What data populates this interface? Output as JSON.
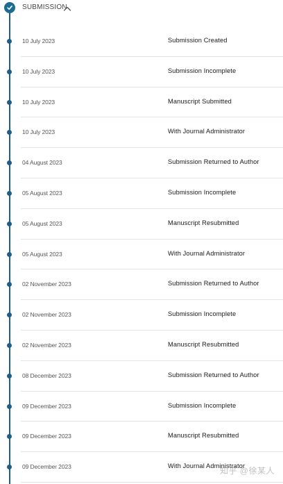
{
  "section": {
    "title": "SUBMISSION",
    "status_icon": "check-icon",
    "toggle_icon": "chevron-up-icon",
    "accent_color": "#1f5f86"
  },
  "history": [
    {
      "date": "10 July 2023",
      "status": "Submission Created"
    },
    {
      "date": "10 July 2023",
      "status": "Submission Incomplete"
    },
    {
      "date": "10 July 2023",
      "status": "Manuscript Submitted"
    },
    {
      "date": "10 July 2023",
      "status": "With Journal Administrator"
    },
    {
      "date": "04 August 2023",
      "status": "Submission Returned to Author"
    },
    {
      "date": "05 August 2023",
      "status": "Submission Incomplete"
    },
    {
      "date": "05 August 2023",
      "status": "Manuscript Resubmitted"
    },
    {
      "date": "05 August 2023",
      "status": "With Journal Administrator"
    },
    {
      "date": "02 November 2023",
      "status": "Submission Returned to Author"
    },
    {
      "date": "02 November 2023",
      "status": "Submission Incomplete"
    },
    {
      "date": "02 November 2023",
      "status": "Manuscript Resubmitted"
    },
    {
      "date": "08 December 2023",
      "status": "Submission Returned to Author"
    },
    {
      "date": "09 December 2023",
      "status": "Submission Incomplete"
    },
    {
      "date": "09 December 2023",
      "status": "Manuscript Resubmitted"
    },
    {
      "date": "09 December 2023",
      "status": "With Journal Administrator"
    }
  ],
  "watermark": {
    "text": "知乎 @徐某人"
  }
}
